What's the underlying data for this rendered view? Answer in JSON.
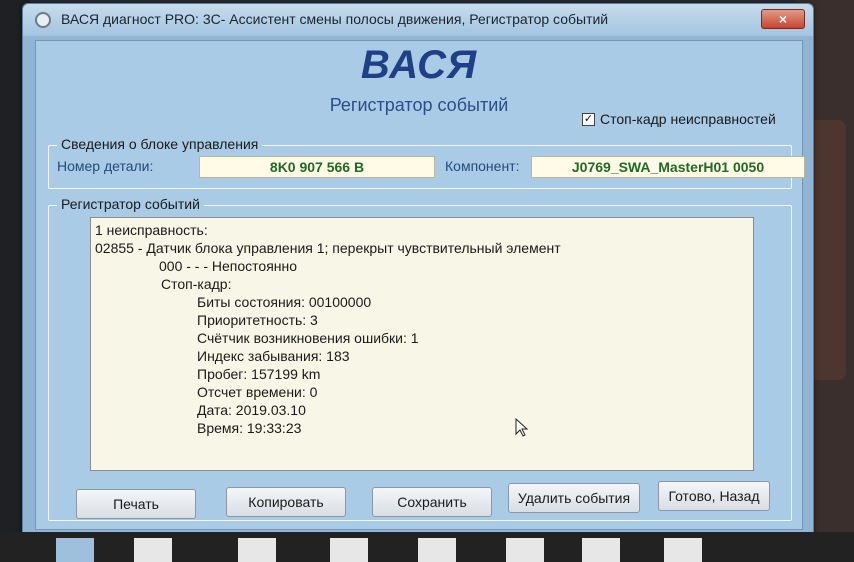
{
  "window": {
    "title": "ВАСЯ диагност PRO: 3C- Ассистент смены полосы движения,  Регистратор событий",
    "close_label": "×"
  },
  "header": {
    "brand": "ВАСЯ",
    "subtitle": "Регистратор событий",
    "freeze_frame_label": "Стоп-кадр неисправностей",
    "freeze_frame_checked": true,
    "checkmark": "✓"
  },
  "control_unit": {
    "legend": "Сведения о блоке управления",
    "part_label": "Номер детали:",
    "part_value": "8K0 907 566 B",
    "component_label": "Компонент:",
    "component_value": "J0769_SWA_MasterH01 0050"
  },
  "event_log": {
    "legend": "Регистратор событий",
    "lines": [
      "1 неисправность:",
      "02855 - Датчик блока управления 1; перекрыт чувствительный элемент",
      "000 - - - Непостоянно",
      "Стоп-кадр:",
      "Биты состояния: 00100000",
      "Приоритетность: 3",
      "Счётчик возникновения ошибки: 1",
      "Индекс забывания: 183",
      "Пробег: 157199 km",
      "Отсчет времени: 0",
      "Дата: 2019.03.10",
      "Время: 19:33:23"
    ]
  },
  "buttons": {
    "print": "Печать",
    "copy": "Копировать",
    "save": "Сохранить",
    "delete_events": "Удалить события",
    "done_back": "Готово, Назад"
  }
}
